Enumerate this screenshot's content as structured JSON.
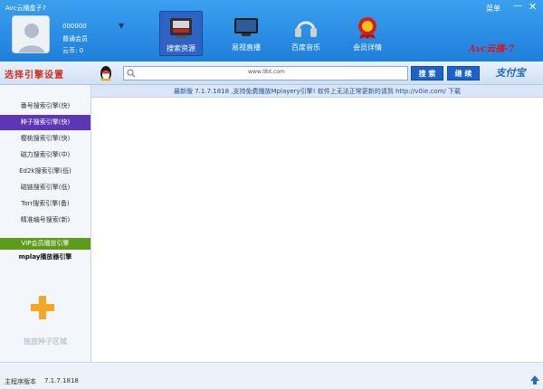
{
  "header": {
    "title": "Avc云播盒子7",
    "menu_label": "菜单",
    "minimize": "—",
    "close": "✕",
    "user": {
      "id": "000000",
      "level": "普通会员",
      "coins": "云币: 0",
      "caret": "▼"
    },
    "tabs": [
      {
        "label": "搜索资源",
        "icon": "search-resource-icon"
      },
      {
        "label": "易视直播",
        "icon": "tv-icon"
      },
      {
        "label": "百度音乐",
        "icon": "headphones-icon"
      },
      {
        "label": "会员详情",
        "icon": "vip-badge-icon"
      }
    ],
    "brand": "Avc云播-7"
  },
  "toolbar": {
    "engine_title": "选择引擎设置",
    "search_value": "www.9bt.com",
    "search_button": "搜 索",
    "continue_button": "继 续",
    "alipay": "支付宝"
  },
  "sidebar": {
    "engines": [
      "番号搜索引擎(快)",
      "种子搜索引擎(快)",
      "樱桃搜索引擎(快)",
      "磁力搜索引擎(中)",
      "Ed2k搜索引擎(低)",
      "磁链搜索引擎(低)",
      "Torr搜索引擎(备)",
      "精准编号搜索(新)"
    ],
    "vip_label": "VIP会员播放引擎",
    "mplay_label": "mplay播放器引擎",
    "drop_label": "拖放种子区域"
  },
  "notice": "最新版 7.1.7.1818 ,支持免费播放Mplayery引擎! 软件上无法正常更新的请到 http://v0ie.com/ 下载",
  "status": {
    "label": "主程序版本",
    "version": "7.1.7.1818"
  },
  "colors": {
    "header_blue": "#1f7fdc",
    "active_engine": "#5d36b5",
    "vip_green": "#5f9b1a",
    "accent_red": "#d62f1d"
  }
}
